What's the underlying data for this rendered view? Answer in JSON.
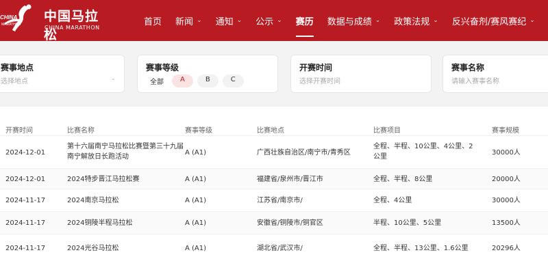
{
  "brand": {
    "logo_mark_text": "CHINA MARATHON",
    "name": "中国马拉松",
    "subtitle": "CHINA MARATHON"
  },
  "nav": {
    "items": [
      {
        "label": "首页",
        "has_dropdown": false,
        "active": false
      },
      {
        "label": "新闻",
        "has_dropdown": true,
        "active": false
      },
      {
        "label": "通知",
        "has_dropdown": true,
        "active": false
      },
      {
        "label": "公示",
        "has_dropdown": true,
        "active": false
      },
      {
        "label": "赛历",
        "has_dropdown": false,
        "active": true
      },
      {
        "label": "数据与成绩",
        "has_dropdown": true,
        "active": false
      },
      {
        "label": "政策法规",
        "has_dropdown": true,
        "active": false
      },
      {
        "label": "反兴奋剂/赛风赛纪",
        "has_dropdown": true,
        "active": false
      }
    ]
  },
  "filters": {
    "location": {
      "label": "赛事地点",
      "placeholder": "选择地点"
    },
    "level": {
      "label": "赛事等级",
      "options": [
        "全部",
        "A",
        "B",
        "C"
      ],
      "selected": "A"
    },
    "start_time": {
      "label": "开赛时间",
      "placeholder": "选择开赛时间"
    },
    "name": {
      "label": "赛事名称",
      "placeholder": "请输入赛事名称"
    }
  },
  "table": {
    "headers": {
      "date": "开赛时间",
      "name": "比赛名称",
      "level": "赛事等级",
      "location": "比赛地点",
      "items": "比赛项目",
      "scale": "赛事规模"
    },
    "rows": [
      {
        "date": "2024-12-01",
        "name": "第十六届南宁马拉松比赛暨第三十九届南宁解放日长跑活动",
        "level": "A (A1)",
        "location": "广西壮族自治区/南宁市/青秀区",
        "items": "全程、半程、10公里、4公里、2公里",
        "scale": "30000人"
      },
      {
        "date": "2024-12-01",
        "name": "2024特步晋江马拉松赛",
        "level": "A (A1)",
        "location": "福建省/泉州市/晋江市",
        "items": "全程、半程、8公里",
        "scale": "20000人"
      },
      {
        "date": "2024-11-17",
        "name": "2024南京马拉松",
        "level": "A (A1)",
        "location": "江苏省/南京市/",
        "items": "全程、4公里",
        "scale": "30000人"
      },
      {
        "date": "2024-11-17",
        "name": "2024铜陵半程马拉松",
        "level": "A (A1)",
        "location": "安徽省/铜陵市/铜官区",
        "items": "半程、10公里、5公里",
        "scale": "13500人"
      },
      {
        "date": "2024-11-17",
        "name": "2024光谷马拉松",
        "level": "A (A1)",
        "location": "湖北省/武汉市/",
        "items": "全程、半程、13公里、1.6公里",
        "scale": "20296人"
      }
    ]
  },
  "colors": {
    "brand_red": "#b81b22",
    "chip_selected_bg": "#fbe3e4"
  }
}
